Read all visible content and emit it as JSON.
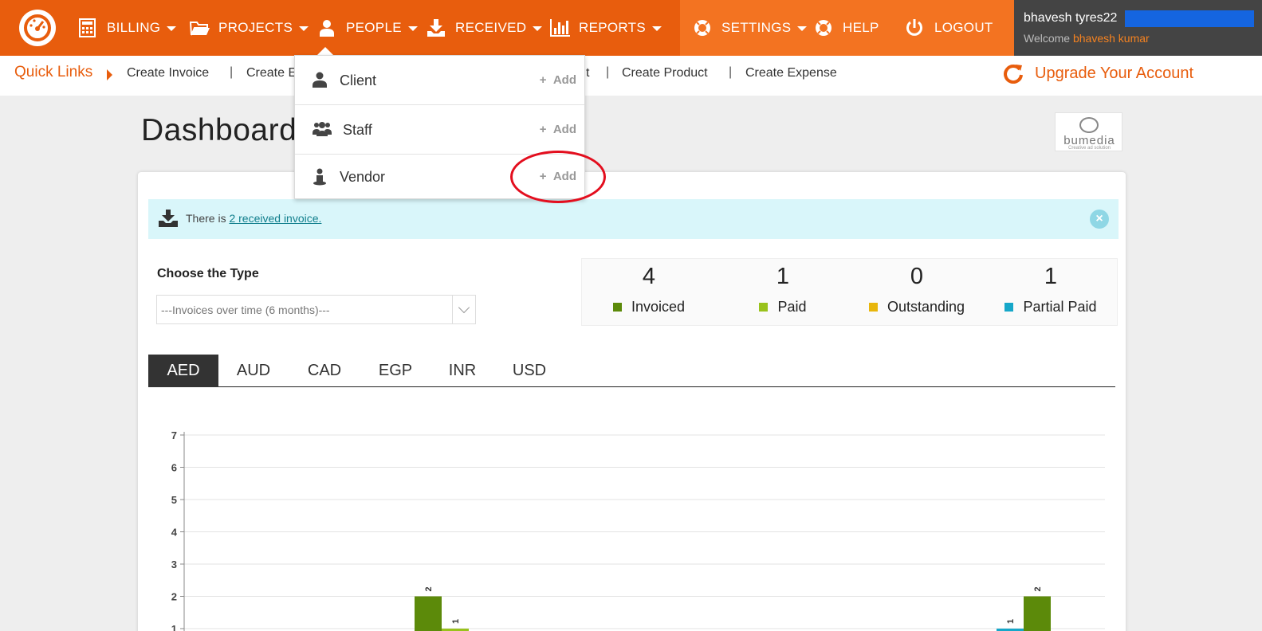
{
  "nav": {
    "items": [
      {
        "label": "BILLING",
        "icon": "calculator-icon"
      },
      {
        "label": "PROJECTS",
        "icon": "folder-icon"
      },
      {
        "label": "PEOPLE",
        "icon": "user-icon"
      },
      {
        "label": "RECEIVED",
        "icon": "download-icon"
      },
      {
        "label": "REPORTS",
        "icon": "bar-chart-icon"
      },
      {
        "label": "SETTINGS",
        "icon": "lifebuoy-icon"
      },
      {
        "label": "HELP",
        "icon": "lifebuoy-icon"
      },
      {
        "label": "LOGOUT",
        "icon": "power-icon"
      }
    ],
    "colors": {
      "primary": "#e85d0d",
      "secondary": "#f37321",
      "user_box": "#444444"
    }
  },
  "user": {
    "name": "bhavesh tyres22",
    "welcome_prefix": "Welcome",
    "welcome_name": "bhavesh kumar"
  },
  "quick_links": {
    "title": "Quick Links",
    "links": [
      "Create Invoice",
      "Create E",
      "t",
      "Create Product",
      "Create Expense"
    ],
    "upgrade": "Upgrade Your Account"
  },
  "dashboard": {
    "title": "Dashboard",
    "logo_text": "bumedia",
    "logo_sub": "Creative ad solution"
  },
  "alert": {
    "prefix": "There is",
    "link": "2 received invoice.",
    "close": "×"
  },
  "type_filter": {
    "label": "Choose the Type",
    "selected": "---Invoices over time (6 months)---"
  },
  "stats": [
    {
      "value": "4",
      "label": "Invoiced",
      "color": "#5c8a0a"
    },
    {
      "value": "1",
      "label": "Paid",
      "color": "#99c21c"
    },
    {
      "value": "0",
      "label": "Outstanding",
      "color": "#e8b60c"
    },
    {
      "value": "1",
      "label": "Partial Paid",
      "color": "#16a7c9"
    }
  ],
  "currency_tabs": [
    "AED",
    "AUD",
    "CAD",
    "EGP",
    "INR",
    "USD"
  ],
  "active_tab": "AED",
  "people_menu": {
    "items": [
      {
        "label": "Client",
        "add": "Add",
        "icon": "user-icon"
      },
      {
        "label": "Staff",
        "add": "Add",
        "icon": "users-icon"
      },
      {
        "label": "Vendor",
        "add": "Add",
        "icon": "vendor-icon"
      }
    ]
  },
  "chart_data": {
    "type": "bar",
    "yticks": [
      "7",
      "6",
      "5",
      "4",
      "3",
      "2",
      "1"
    ],
    "ylim": [
      0,
      7
    ],
    "grid": true,
    "groups": [
      {
        "bars": [
          {
            "series": "Invoiced",
            "value": 2,
            "color": "#5c8a0a"
          },
          {
            "series": "Paid",
            "value": 1,
            "color": "#99c21c"
          }
        ]
      },
      {
        "bars": [
          {
            "series": "Partial Paid",
            "value": 1,
            "color": "#16a7c9"
          },
          {
            "series": "Invoiced",
            "value": 2,
            "color": "#5c8a0a"
          }
        ]
      }
    ]
  }
}
